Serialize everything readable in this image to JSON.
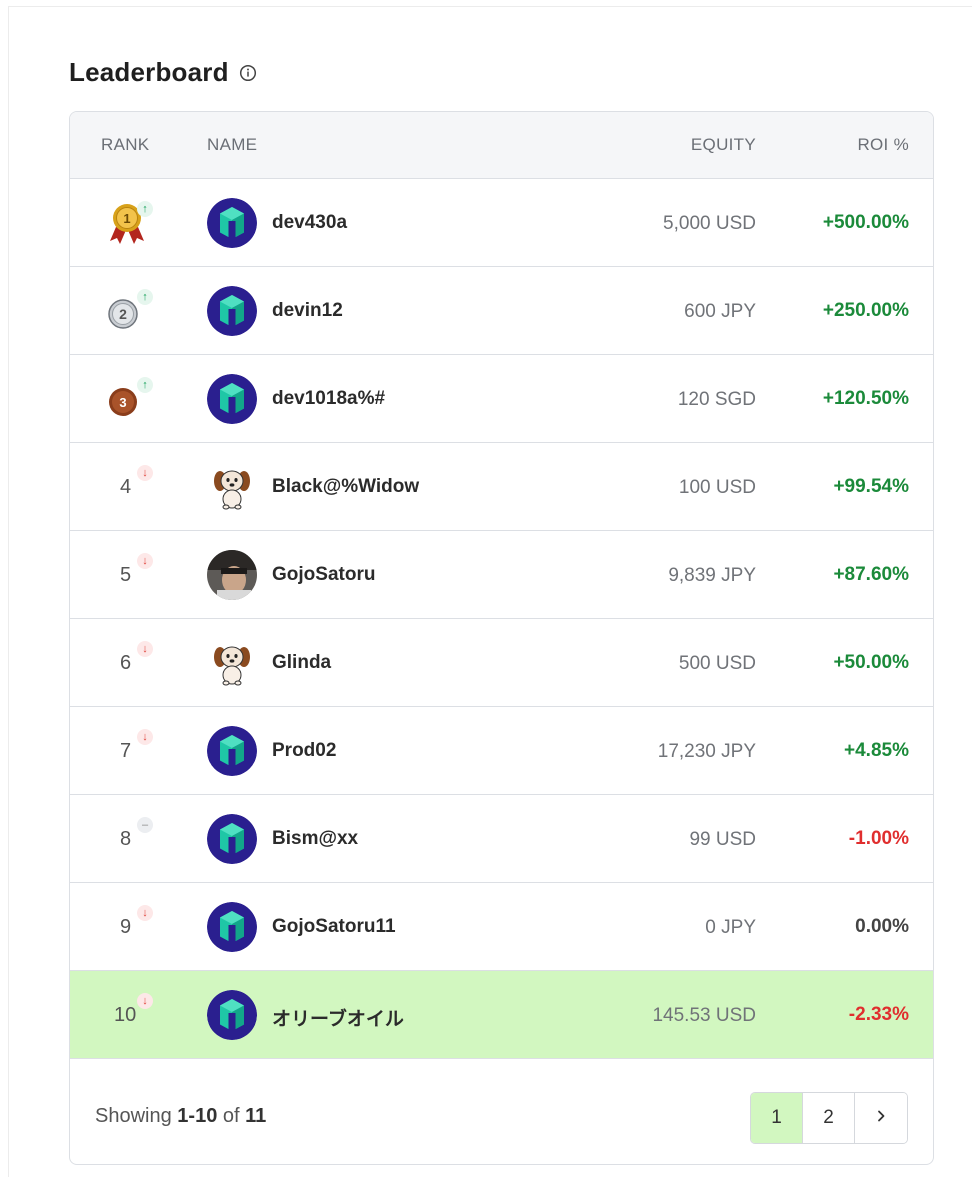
{
  "header": {
    "title": "Leaderboard",
    "info_icon": "info-circle-icon"
  },
  "table": {
    "columns": {
      "rank": "RANK",
      "name": "NAME",
      "equity": "EQUITY",
      "roi": "ROI %"
    },
    "rows": [
      {
        "rank": "1",
        "medal": "gold",
        "trend": "up",
        "avatar": "cube",
        "name": "dev430a",
        "equity": "5,000 USD",
        "roi": "+500.00%",
        "roi_sign": "pos"
      },
      {
        "rank": "2",
        "medal": "silver",
        "trend": "up",
        "avatar": "cube",
        "name": "devin12",
        "equity": "600 JPY",
        "roi": "+250.00%",
        "roi_sign": "pos"
      },
      {
        "rank": "3",
        "medal": "bronze",
        "trend": "up",
        "avatar": "cube",
        "name": "dev1018a%#",
        "equity": "120 SGD",
        "roi": "+120.50%",
        "roi_sign": "pos"
      },
      {
        "rank": "4",
        "medal": "",
        "trend": "down",
        "avatar": "dog",
        "name": "Black@%Widow",
        "equity": "100 USD",
        "roi": "+99.54%",
        "roi_sign": "pos"
      },
      {
        "rank": "5",
        "medal": "",
        "trend": "down",
        "avatar": "photo",
        "name": "GojoSatoru",
        "equity": "9,839 JPY",
        "roi": "+87.60%",
        "roi_sign": "pos"
      },
      {
        "rank": "6",
        "medal": "",
        "trend": "down",
        "avatar": "dog",
        "name": "Glinda",
        "equity": "500 USD",
        "roi": "+50.00%",
        "roi_sign": "pos"
      },
      {
        "rank": "7",
        "medal": "",
        "trend": "down",
        "avatar": "cube",
        "name": "Prod02",
        "equity": "17,230 JPY",
        "roi": "+4.85%",
        "roi_sign": "pos"
      },
      {
        "rank": "8",
        "medal": "",
        "trend": "same",
        "avatar": "cube",
        "name": "Bism@xx",
        "equity": "99 USD",
        "roi": "-1.00%",
        "roi_sign": "neg"
      },
      {
        "rank": "9",
        "medal": "",
        "trend": "down",
        "avatar": "cube",
        "name": "GojoSatoru11",
        "equity": "0 JPY",
        "roi": "0.00%",
        "roi_sign": "zero"
      },
      {
        "rank": "10",
        "medal": "",
        "trend": "down",
        "avatar": "cube",
        "name": "オリーブオイル",
        "equity": "145.53 USD",
        "roi": "-2.33%",
        "roi_sign": "neg",
        "highlight": true
      }
    ]
  },
  "footer": {
    "showing_prefix": "Showing",
    "showing_range": "1-10",
    "showing_of": "of",
    "showing_total": "11",
    "pages": [
      "1",
      "2"
    ],
    "active_page": "1",
    "next_icon": "chevron-right-icon"
  },
  "colors": {
    "highlight": "#d2f7c0",
    "positive": "#1b8a3a",
    "negative": "#e02e2e",
    "avatar_bg": "#2a1f8f",
    "avatar_cube": "#1fc7a6"
  }
}
